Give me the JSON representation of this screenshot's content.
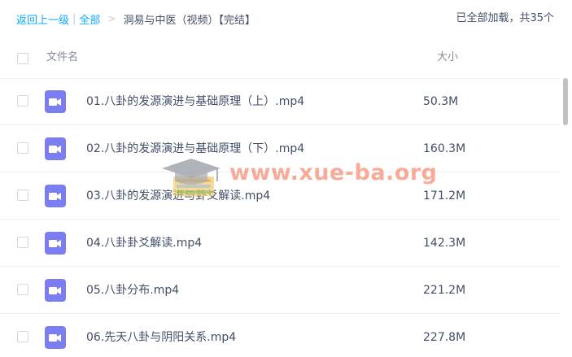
{
  "breadcrumb": {
    "back_label": "返回上一级",
    "separator": "|",
    "all_label": "全部",
    "chevron": ">",
    "current_folder": "洞易与中医（视频）【完结】"
  },
  "summary": "已全部加载，共35个",
  "columns": {
    "name": "文件名",
    "size": "大小"
  },
  "files": [
    {
      "name": "01.八卦的发源演进与基础原理（上）.mp4",
      "size": "50.3M"
    },
    {
      "name": "02.八卦的发源演进与基础原理（下）.mp4",
      "size": "160.3M"
    },
    {
      "name": "03.八卦的发源演进与卦爻解读.mp4",
      "size": "171.2M"
    },
    {
      "name": "04.八卦卦爻解读.mp4",
      "size": "142.3M"
    },
    {
      "name": "05.八卦分布.mp4",
      "size": "221.2M"
    },
    {
      "name": "06.先天八卦与阴阳关系.mp4",
      "size": "227.8M"
    }
  ],
  "watermark": {
    "text": "www.xue-ba.org"
  },
  "colors": {
    "link": "#09aaff",
    "text": "#424e67",
    "muted": "#878c9c",
    "video_icon": "#7b7ef1"
  },
  "icons": {
    "file": "video-file-icon",
    "watermark": "graduation-cap-icon"
  }
}
